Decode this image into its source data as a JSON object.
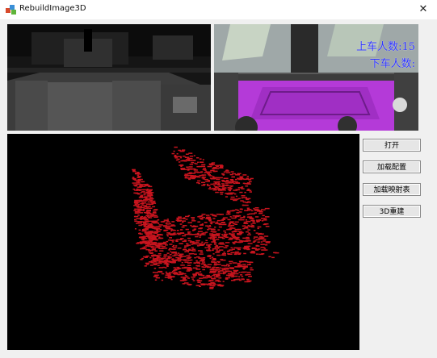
{
  "window": {
    "title": "RebuildImage3D",
    "close_symbol": "✕"
  },
  "images": {
    "depth_view": {
      "icon": "depth-map-image"
    },
    "color_view": {
      "icon": "camera-image",
      "overlay_line1": "上车人数:15",
      "overlay_line2": "下车人数:"
    },
    "point_cloud_view": {
      "icon": "point-cloud-image",
      "point_color": "#c8141e"
    }
  },
  "buttons": {
    "open": "打开",
    "load_config": "加载配置",
    "load_mapping_table": "加载映射表",
    "rebuild_3d": "3D重建"
  },
  "colors": {
    "window_bg": "#f0f0f0",
    "view_bg": "#000000",
    "overlay_text": "#2f35ff",
    "carpet_magenta": "#b43ad8"
  }
}
